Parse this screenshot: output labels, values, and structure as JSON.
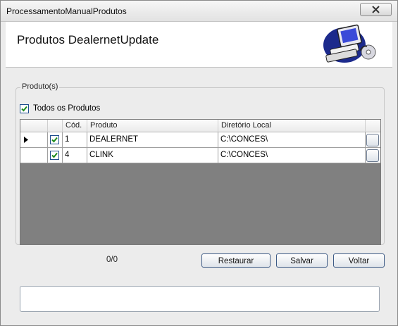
{
  "window": {
    "title": "ProcessamentoManualProdutos"
  },
  "header": {
    "title": "Produtos DealernetUpdate",
    "logo_icon": "computer-workstation-icon"
  },
  "group": {
    "legend": "Produto(s)"
  },
  "all_products": {
    "label": "Todos os Produtos",
    "checked": true
  },
  "grid": {
    "columns": [
      "Cód.",
      "Produto",
      "Diretório Local"
    ],
    "rows": [
      {
        "current": true,
        "checked": true,
        "code": "1",
        "product": "DEALERNET",
        "directory": "C:\\CONCES\\"
      },
      {
        "current": false,
        "checked": true,
        "code": "4",
        "product": "CLINK",
        "directory": "C:\\CONCES\\"
      }
    ]
  },
  "page_counter": "0/0",
  "buttons": {
    "restore": "Restaurar",
    "save": "Salvar",
    "back": "Voltar"
  },
  "status": {
    "text": ""
  },
  "colors": {
    "grid_background": "#808080",
    "button_border": "#3c5a85",
    "checkmark": "#1a8a1a"
  }
}
